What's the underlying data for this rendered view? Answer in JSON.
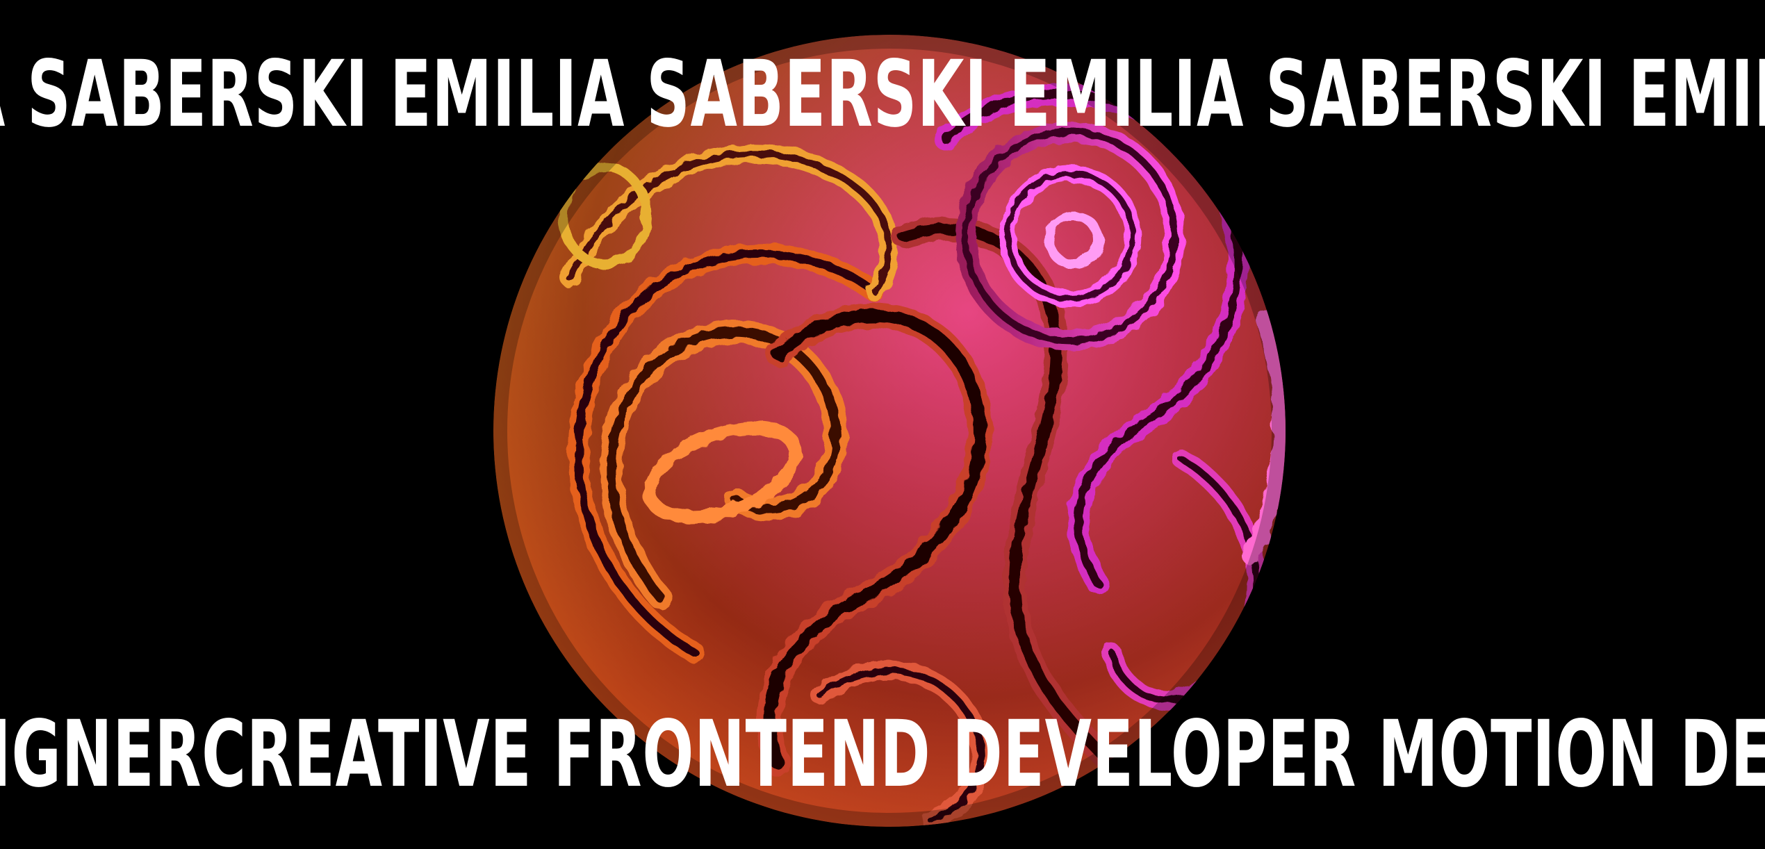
{
  "marquee_top": {
    "text": "A SABERSKI EMILIA SABERSKI EMILIA SABERSKI EMILIA SABERSKI EMILIA"
  },
  "marquee_bottom": {
    "text": "SIGNERCREATIVE FRONTEND DEVELOPER MOTION DESIGNER"
  },
  "colors": {
    "background": "#000000",
    "text": "#ffffff",
    "sphere_orange": "#d9571c",
    "sphere_magenta": "#d81fb6",
    "sphere_dark": "#2a0508"
  },
  "icons": {
    "hero_visual": "swirled-metallic-sphere"
  }
}
